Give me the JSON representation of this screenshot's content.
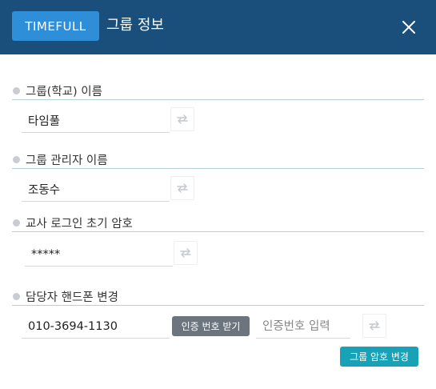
{
  "header": {
    "logo": "TIMEFULL",
    "title": "그룹 정보",
    "close_icon": "close-icon"
  },
  "group_name": {
    "label": "그룹(학교) 이름",
    "value": "타임풀"
  },
  "admin_name": {
    "label": "그룹 관리자 이름",
    "value": "조동수"
  },
  "teacher_password": {
    "label": "교사 로그인 초기 암호",
    "value": "*****"
  },
  "phone": {
    "label": "담당자 핸드폰 변경",
    "value": "010-3694-1130",
    "verify_button": "인증 번호 받기",
    "code_placeholder": "인증번호 입력"
  },
  "change_password_button": "그룹 암호 변경",
  "colors": {
    "header_bg": "#1a4f7c",
    "logo_bg": "#2e8fd8",
    "verify_bg": "#6c757d",
    "change_bg": "#17a2b8"
  },
  "icons": {
    "swap": "swap-arrows-icon",
    "bullet": "bullet-dot-icon"
  }
}
